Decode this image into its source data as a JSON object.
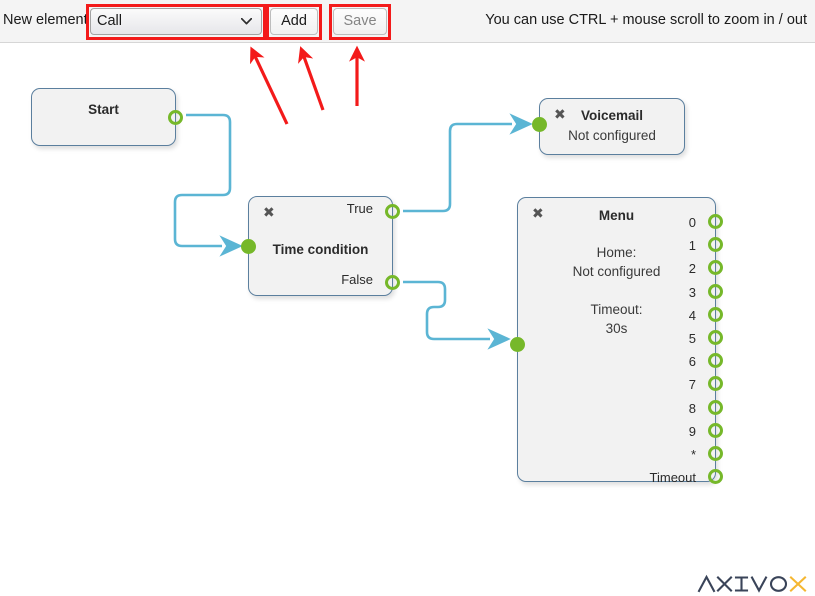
{
  "toolbar": {
    "new_element_label": "New element",
    "element_select": {
      "value": "Call",
      "icon": "chevron-down-icon"
    },
    "add_label": "Add",
    "save_label": "Save",
    "zoom_hint": "You can use CTRL + mouse scroll to zoom in / out"
  },
  "annotations": {
    "highlight_color": "#f31a1a",
    "arrow_color": "#f31a1a",
    "highlighted": [
      "element-select",
      "add-button",
      "save-button"
    ]
  },
  "colors": {
    "node_fill": "#f2f2f2",
    "node_border": "#5b7f9e",
    "port_green": "#76b82a",
    "edge_blue": "#5bb5d4",
    "logo_dark": "#3a4459",
    "logo_accent": "#f5b731"
  },
  "nodes": [
    {
      "id": "start",
      "title": "Start",
      "subtitle": null,
      "closable": false,
      "outputs": [
        {
          "label": "",
          "name": "start-output"
        }
      ],
      "inputs": []
    },
    {
      "id": "timecond",
      "title": "Time condition",
      "subtitle": null,
      "closable": true,
      "close_icon": "close-icon",
      "outputs": [
        {
          "label": "True",
          "name": "timecond-output-true"
        },
        {
          "label": "False",
          "name": "timecond-output-false"
        }
      ],
      "inputs": [
        {
          "name": "timecond-input"
        }
      ]
    },
    {
      "id": "voicemail",
      "title": "Voicemail",
      "subtitle": "Not configured",
      "closable": true,
      "close_icon": "close-icon",
      "outputs": [],
      "inputs": [
        {
          "name": "voicemail-input"
        }
      ]
    },
    {
      "id": "menu",
      "title": "Menu",
      "home_label": "Home:",
      "home_value": "Not configured",
      "timeout_label": "Timeout:",
      "timeout_value": "30s",
      "closable": true,
      "close_icon": "close-icon",
      "outputs": [
        {
          "label": "0"
        },
        {
          "label": "1"
        },
        {
          "label": "2"
        },
        {
          "label": "3"
        },
        {
          "label": "4"
        },
        {
          "label": "5"
        },
        {
          "label": "6"
        },
        {
          "label": "7"
        },
        {
          "label": "8"
        },
        {
          "label": "9"
        },
        {
          "label": "*"
        },
        {
          "label": "Timeout"
        }
      ],
      "inputs": [
        {
          "name": "menu-input"
        }
      ]
    }
  ],
  "edges": [
    {
      "from": "start-output",
      "to": "timecond-input"
    },
    {
      "from": "timecond-output-true",
      "to": "voicemail-input"
    },
    {
      "from": "timecond-output-false",
      "to": "menu-input"
    }
  ],
  "logo": {
    "text": "AXIVOX",
    "accent_letter": "X"
  }
}
